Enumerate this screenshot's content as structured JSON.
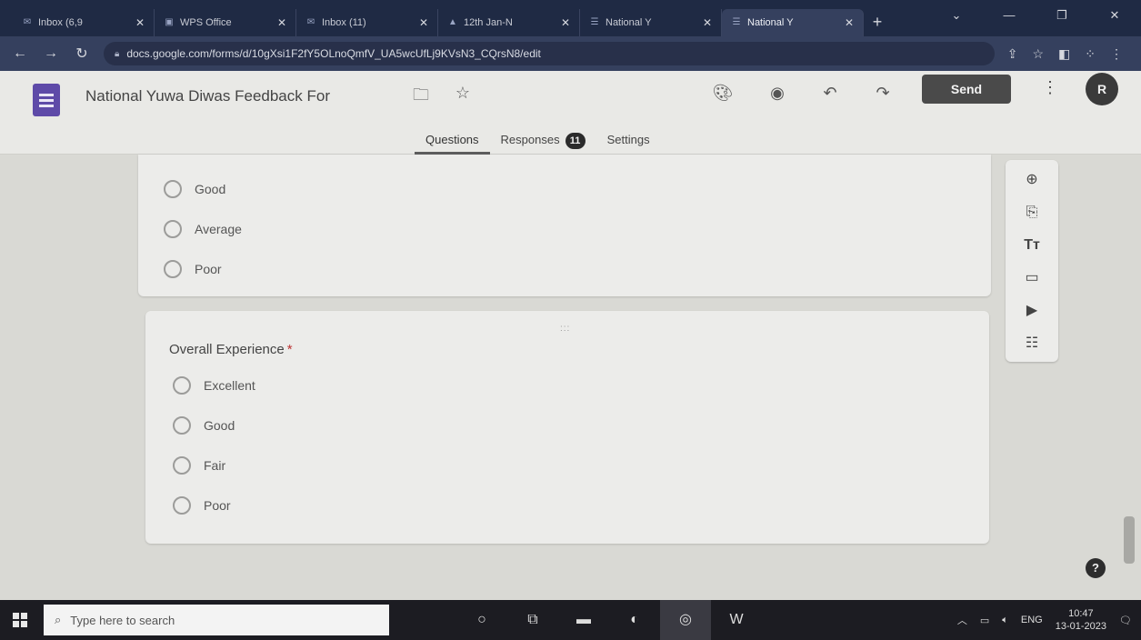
{
  "browser": {
    "tabs": [
      {
        "label": "Inbox (6,9",
        "icon": "gmail-icon",
        "active": false
      },
      {
        "label": "WPS Office",
        "icon": "wps-icon",
        "active": false
      },
      {
        "label": "Inbox (11)",
        "icon": "gmail-icon",
        "active": false
      },
      {
        "label": "12th Jan-N",
        "icon": "drive-icon",
        "active": false
      },
      {
        "label": "National Y",
        "icon": "forms-icon",
        "active": false
      },
      {
        "label": "National Y",
        "icon": "forms-icon",
        "active": true
      }
    ],
    "url": "docs.google.com/forms/d/10gXsi1F2fY5OLnoQmfV_UA5wcUfLj9KVsN3_CQrsN8/edit"
  },
  "form_header": {
    "title": "National Yuwa Diwas Feedback For",
    "send_label": "Send",
    "avatar_initials": "R",
    "tabs": [
      {
        "label": "Questions"
      },
      {
        "label": "Responses",
        "badge": "11"
      },
      {
        "label": "Settings"
      }
    ]
  },
  "previous_question": {
    "options": [
      "Good",
      "Average",
      "Poor"
    ]
  },
  "overall_question": {
    "title": "Overall Experience",
    "required_mark": "*",
    "drag_handle": ":::",
    "options": [
      "Excellent",
      "Good",
      "Fair",
      "Poor"
    ]
  },
  "taskbar": {
    "search_placeholder": "Type here to search",
    "language": "ENG",
    "time": "10:47",
    "date": "13-01-2023"
  },
  "colors": {
    "send_button": "#4a4a4a",
    "forms_brand": "#5e4aa8",
    "canvas": "#d9d9d4"
  }
}
